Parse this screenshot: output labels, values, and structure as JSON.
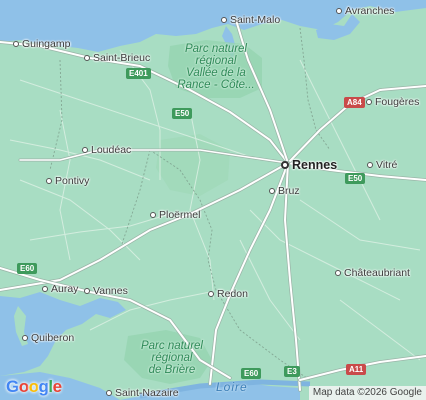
{
  "map": {
    "cities": [
      {
        "id": "saint-malo",
        "label": "Saint-Malo",
        "major": false
      },
      {
        "id": "avranches",
        "label": "Avranches",
        "major": false
      },
      {
        "id": "guingamp",
        "label": "Guingamp",
        "major": false
      },
      {
        "id": "saint-brieuc",
        "label": "Saint-Brieuc",
        "major": false
      },
      {
        "id": "fougeres",
        "label": "Fougères",
        "major": false
      },
      {
        "id": "loudeac",
        "label": "Loudéac",
        "major": false
      },
      {
        "id": "rennes",
        "label": "Rennes",
        "major": true
      },
      {
        "id": "vitre",
        "label": "Vitré",
        "major": false
      },
      {
        "id": "pontivy",
        "label": "Pontivy",
        "major": false
      },
      {
        "id": "bruz",
        "label": "Bruz",
        "major": false
      },
      {
        "id": "ploermel",
        "label": "Ploërmel",
        "major": false
      },
      {
        "id": "chateaubriant",
        "label": "Châteaubriant",
        "major": false
      },
      {
        "id": "auray",
        "label": "Auray",
        "major": false
      },
      {
        "id": "vannes",
        "label": "Vannes",
        "major": false
      },
      {
        "id": "redon",
        "label": "Redon",
        "major": false
      },
      {
        "id": "quiberon",
        "label": "Quiberon",
        "major": false
      },
      {
        "id": "saint-nazaire",
        "label": "Saint-Nazaire",
        "major": false
      }
    ],
    "parks": [
      {
        "id": "rance",
        "lines": [
          "Parc naturel",
          "régional",
          "Vallée de la",
          "Rance - Côte..."
        ]
      },
      {
        "id": "briere",
        "lines": [
          "Parc naturel",
          "régional",
          "de Brière"
        ]
      }
    ],
    "roads": [
      {
        "id": "e401",
        "label": "E401",
        "color": "green"
      },
      {
        "id": "e50-north",
        "label": "E50",
        "color": "green"
      },
      {
        "id": "a84",
        "label": "A84",
        "color": "red"
      },
      {
        "id": "e50-east",
        "label": "E50",
        "color": "green"
      },
      {
        "id": "e60-west",
        "label": "E60",
        "color": "green"
      },
      {
        "id": "e60-south",
        "label": "E60",
        "color": "green"
      },
      {
        "id": "e3",
        "label": "E3",
        "color": "green"
      },
      {
        "id": "a11",
        "label": "A11",
        "color": "red"
      }
    ],
    "river_label": "Loire",
    "colors": {
      "land": "#a8ddc3",
      "sea": "#8fc1e8",
      "park": "#95d4b0",
      "road_major": "#ffffff",
      "road_outline": "#9bb5a8",
      "border": "#7a9a88"
    }
  },
  "logo": {
    "letters": [
      "G",
      "o",
      "o",
      "g",
      "l",
      "e"
    ],
    "colors": [
      "#4285F4",
      "#EA4335",
      "#FBBC05",
      "#4285F4",
      "#34A853",
      "#EA4335"
    ]
  },
  "attribution": "Map data ©2026 Google"
}
